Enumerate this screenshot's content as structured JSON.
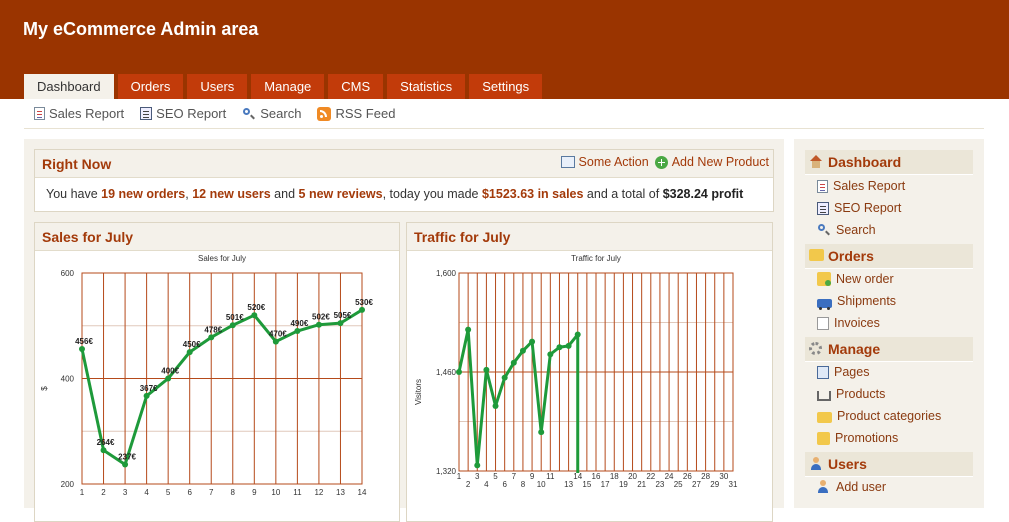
{
  "header": {
    "title": "My eCommerce Admin area"
  },
  "tabs": [
    {
      "label": "Dashboard",
      "active": true
    },
    {
      "label": "Orders"
    },
    {
      "label": "Users"
    },
    {
      "label": "Manage"
    },
    {
      "label": "CMS"
    },
    {
      "label": "Statistics"
    },
    {
      "label": "Settings"
    }
  ],
  "subnav": [
    {
      "label": "Sales Report",
      "icon": "report-icon"
    },
    {
      "label": "SEO Report",
      "icon": "seo-report-icon"
    },
    {
      "label": "Search",
      "icon": "search-icon"
    },
    {
      "label": "RSS Feed",
      "icon": "rss-icon"
    }
  ],
  "right_now": {
    "title": "Right Now",
    "actions": {
      "some_action": "Some Action",
      "add_product": "Add New Product"
    },
    "summary": {
      "p1": "You have ",
      "orders": "19 new orders",
      "p2": ", ",
      "users": "12 new users",
      "p3": " and ",
      "reviews": "5 new reviews",
      "p4": ", today you made ",
      "sales": "$1523.63 in sales",
      "p5": " and a total of ",
      "profit": "$328.24 profit"
    }
  },
  "sales_box": {
    "title": "Sales for July"
  },
  "traffic_box": {
    "title": "Traffic for July"
  },
  "chart_data": [
    {
      "type": "line",
      "title": "Sales for July",
      "ylabel": "$",
      "x": [
        1,
        2,
        3,
        4,
        5,
        6,
        7,
        8,
        9,
        10,
        11,
        12,
        13,
        14
      ],
      "values": [
        456,
        264,
        237,
        367,
        400,
        450,
        478,
        501,
        520,
        470,
        490,
        502,
        505,
        530
      ],
      "point_labels": [
        "456€",
        "264€",
        "237€",
        "367€",
        "400€",
        "450€",
        "478€",
        "501€",
        "520€",
        "470€",
        "490€",
        "502€",
        "505€",
        "530€"
      ],
      "y_ticks": [
        "200",
        "400",
        "600"
      ],
      "ylim": [
        200,
        600
      ],
      "color": "#1e9a3a"
    },
    {
      "type": "line",
      "title": "Traffic for July",
      "ylabel": "Visitors",
      "x": [
        1,
        2,
        3,
        4,
        5,
        6,
        7,
        8,
        9,
        10,
        11,
        12,
        13,
        14
      ],
      "values": [
        1460,
        1520,
        1328,
        1463,
        1412,
        1452,
        1473,
        1490,
        1503,
        1375,
        1485,
        1495,
        1497,
        1513
      ],
      "x_ticks": [
        "1",
        "2",
        "3",
        "4",
        "5",
        "6",
        "7",
        "8",
        "9",
        "10",
        "11",
        "13",
        "14",
        "15",
        "16",
        "17",
        "18",
        "19",
        "20",
        "21",
        "22",
        "23",
        "24",
        "25",
        "26",
        "27",
        "28",
        "29",
        "30",
        "31"
      ],
      "y_ticks": [
        "1,320",
        "1,460",
        "1,600"
      ],
      "ylim": [
        1320,
        1600
      ],
      "color": "#1e9a3a"
    }
  ],
  "sidebar": {
    "sections": [
      {
        "title": "Dashboard",
        "icon": "home-icon",
        "items": [
          {
            "label": "Sales Report",
            "icon": "report-icon"
          },
          {
            "label": "SEO Report",
            "icon": "seo-report-icon"
          },
          {
            "label": "Search",
            "icon": "search-icon"
          }
        ]
      },
      {
        "title": "Orders",
        "icon": "folder-icon",
        "items": [
          {
            "label": "New order",
            "icon": "new-order-icon"
          },
          {
            "label": "Shipments",
            "icon": "truck-icon"
          },
          {
            "label": "Invoices",
            "icon": "invoice-icon"
          }
        ]
      },
      {
        "title": "Manage",
        "icon": "gear-icon",
        "items": [
          {
            "label": "Pages",
            "icon": "pages-icon"
          },
          {
            "label": "Products",
            "icon": "cart-icon"
          },
          {
            "label": "Product categories",
            "icon": "folder-icon"
          },
          {
            "label": "Promotions",
            "icon": "promotions-icon"
          }
        ]
      },
      {
        "title": "Users",
        "icon": "user-icon",
        "items": [
          {
            "label": "Add user",
            "icon": "add-user-icon"
          }
        ]
      }
    ]
  }
}
